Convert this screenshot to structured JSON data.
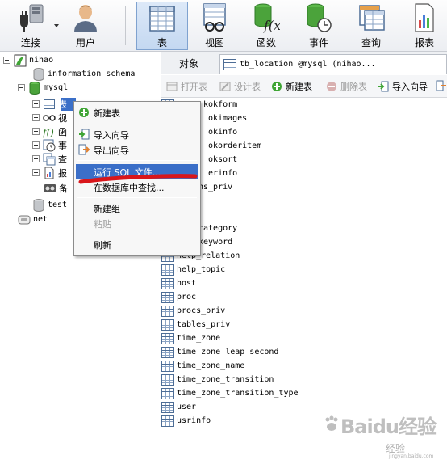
{
  "toolbar": {
    "buttons": [
      {
        "label": "连接"
      },
      {
        "label": "用户"
      },
      {
        "label": "表"
      },
      {
        "label": "视图"
      },
      {
        "label": "函数"
      },
      {
        "label": "事件"
      },
      {
        "label": "查询"
      },
      {
        "label": "报表"
      }
    ]
  },
  "tree": {
    "connection": "nihao",
    "databases": [
      "information_schema",
      "mysql"
    ],
    "mysql_children": [
      "表",
      "视",
      "函",
      "事",
      "查",
      "报",
      "备"
    ],
    "other_databases": [
      "test"
    ],
    "other_connection": "net"
  },
  "tabs": {
    "objects_label": "对象",
    "active_tab_label": "tb_location @mysql (nihao..."
  },
  "object_toolbar": {
    "open": "打开表",
    "design": "设计表",
    "new": "新建表",
    "delete": "删除表",
    "import": "导入向导"
  },
  "tables_visible": [
    "kokform",
    "okimages",
    "okinfo",
    "okorderitem",
    "oksort",
    "erinfo",
    "ns_priv",
    "category",
    "keyword",
    "help_relation",
    "help_topic",
    "host",
    "proc",
    "procs_priv",
    "tables_priv",
    "time_zone",
    "time_zone_leap_second",
    "time_zone_name",
    "time_zone_transition",
    "time_zone_transition_type",
    "user",
    "usrinfo"
  ],
  "context_menu": {
    "new_table": "新建表",
    "import_wizard": "导入向导",
    "export_wizard": "导出向导",
    "run_sql_file": "运行 SQL 文件...",
    "find_in_db": "在数据库中查找...",
    "new_group": "新建组",
    "paste": "粘贴",
    "refresh": "刷新"
  },
  "watermark": {
    "brand": "Baidu经验",
    "sub": "经验",
    "url": "jingyan.baidu.com"
  },
  "colors": {
    "selection": "#3b6fc8",
    "annotation_red": "#d9161b",
    "db_green": "#3fa535"
  }
}
